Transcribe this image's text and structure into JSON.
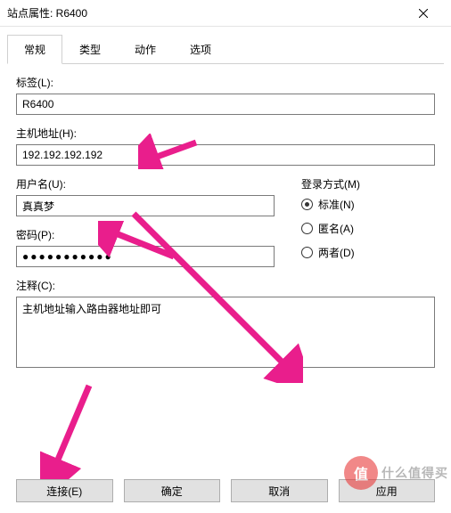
{
  "window": {
    "title": "站点属性: R6400"
  },
  "tabs": {
    "items": [
      "常规",
      "类型",
      "动作",
      "选项"
    ],
    "active": 0
  },
  "fields": {
    "label": {
      "caption": "标签(L):",
      "value": "R6400"
    },
    "host": {
      "caption": "主机地址(H):",
      "value": "192.192.192.192"
    },
    "username": {
      "caption": "用户名(U):",
      "value": "真真梦"
    },
    "password": {
      "caption": "密码(P):",
      "value": "●●●●●●●●●●●"
    },
    "loginMethod": {
      "caption": "登录方式(M)",
      "options": [
        {
          "label": "标准(N)",
          "checked": true
        },
        {
          "label": "匿名(A)",
          "checked": false
        },
        {
          "label": "两者(D)",
          "checked": false
        }
      ]
    },
    "comment": {
      "caption": "注释(C):",
      "value": "主机地址输入路由器地址即可"
    }
  },
  "buttons": {
    "connect": "连接(E)",
    "ok": "确定",
    "cancel": "取消",
    "apply": "应用"
  },
  "arrowColor": "#e91e8c",
  "watermark": {
    "icon": "值",
    "text": "什么值得买"
  }
}
